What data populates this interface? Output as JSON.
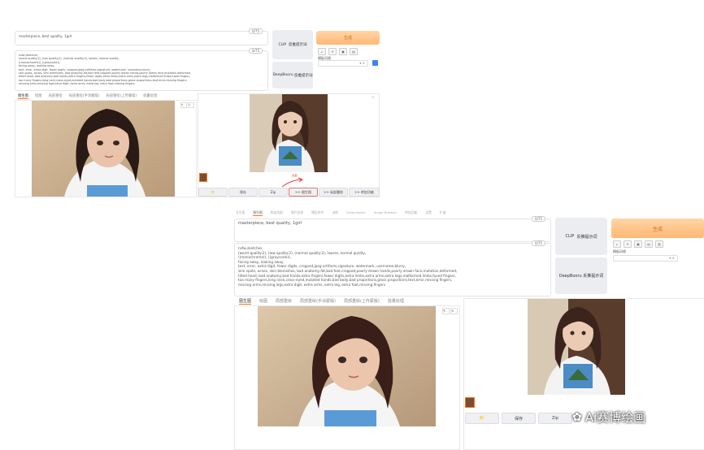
{
  "top": {
    "positive_prompt": "masterpiece, best quality, 1girl",
    "positive_count": "0/75",
    "negative_prompt": "nsfw,sketches,\n(worst quality:2), (low quality:2), (normal quality:2), lowres, normal quality,\n((monochrome)), ((grayscale)),\nfacing away, looking away,\ntext, error, extra digit, fewer digits, cropped,jpeg artifacts,signature, watermark, username,blurry,\nskin spots, acnes, skin blemishes, bad anatomy,fat,bad feet,cropped,poorly drawn hands,poorly drawn face,mutation,deformed,\ntilted head, bad anatomy,bad hands,extra fingers,fewer digits,extra limbs,extra arms,extra legs,malformed limbs,fused fingers,\ntoo many fingers,long neck,cross-eyed,mutated hands,bad body,bad proportions,gross proportions,text,error,missing fingers,\nmissing arms,missing legs,extra digit, extra arms, extra leg, extra foot,missing fingers",
    "negative_count": "0/75",
    "clip_label": "CLIP",
    "clip_action": "反推提示词",
    "deepbooru_label": "DeepBooru",
    "deepbooru_action": "反推提示词",
    "generate": "生成",
    "style_label": "模板风格",
    "tools": [
      "↙",
      "🗑",
      "▣",
      "▤",
      "▥"
    ],
    "tabs": [
      "图生图",
      "绘图",
      "局部重绘",
      "局部重绘(手涂蒙版)",
      "局部重绘(上传蒙版)",
      "批量处理"
    ],
    "arrow_note": "点此",
    "bottom_buttons": [
      "📁",
      "保存",
      "Zip",
      ">> 图生图",
      ">> 局部重绘",
      ">> 附加功能"
    ]
  },
  "bottom": {
    "top_tabs": [
      "文生图",
      "图生图",
      "附加功能",
      "图片信息",
      "模型合并",
      "训练",
      "Dreambooth",
      "Image Browser",
      "附加功能",
      "设置",
      "扩展"
    ],
    "positive_prompt": "masterpiece, best quality, 1girl",
    "positive_count": "0/75",
    "negative_prompt": "nsfw,sketches,\n(worst quality:2), (low quality:2), (normal quality:2), lowres, normal quality,\n((monochrome)), ((grayscale)),\nfacing away, looking away,\ntext, error, extra digit, fewer digits, cropped,jpeg artifacts,signature, watermark, username,blurry,\nskin spots, acnes, skin blemishes, bad anatomy,fat,bad feet,cropped,poorly drawn hands,poorly drawn face,mutation,deformed,\ntilted head, bad anatomy,bad hands,extra fingers,fewer digits,extra limbs,extra arms,extra legs,malformed limbs,fused fingers,\ntoo many fingers,long neck,cross-eyed,mutated hands,bad body,bad proportions,gross proportions,text,error,missing fingers,\nmissing arms,missing legs,extra digit, extra arms, extra leg, extra foot,missing fingers",
    "negative_count": "0/75",
    "clip_label": "CLIP",
    "clip_action": "反推提示词",
    "deepbooru_label": "DeepBooru",
    "deepbooru_action": "反推提示词",
    "generate": "生成",
    "style_label": "模板风格",
    "tabs": [
      "图生图",
      "绘图",
      "局部重绘",
      "局部重绘(手涂蒙版)",
      "局部重绘(上传蒙版)",
      "批量处理"
    ],
    "bottom_buttons": [
      "📁",
      "保存",
      "Zip"
    ]
  },
  "watermark": "Ai赛博绘画",
  "colors": {
    "accent": "#f97316",
    "generate_bg": "#ffc58a",
    "side_btn": "#ecedf1"
  }
}
